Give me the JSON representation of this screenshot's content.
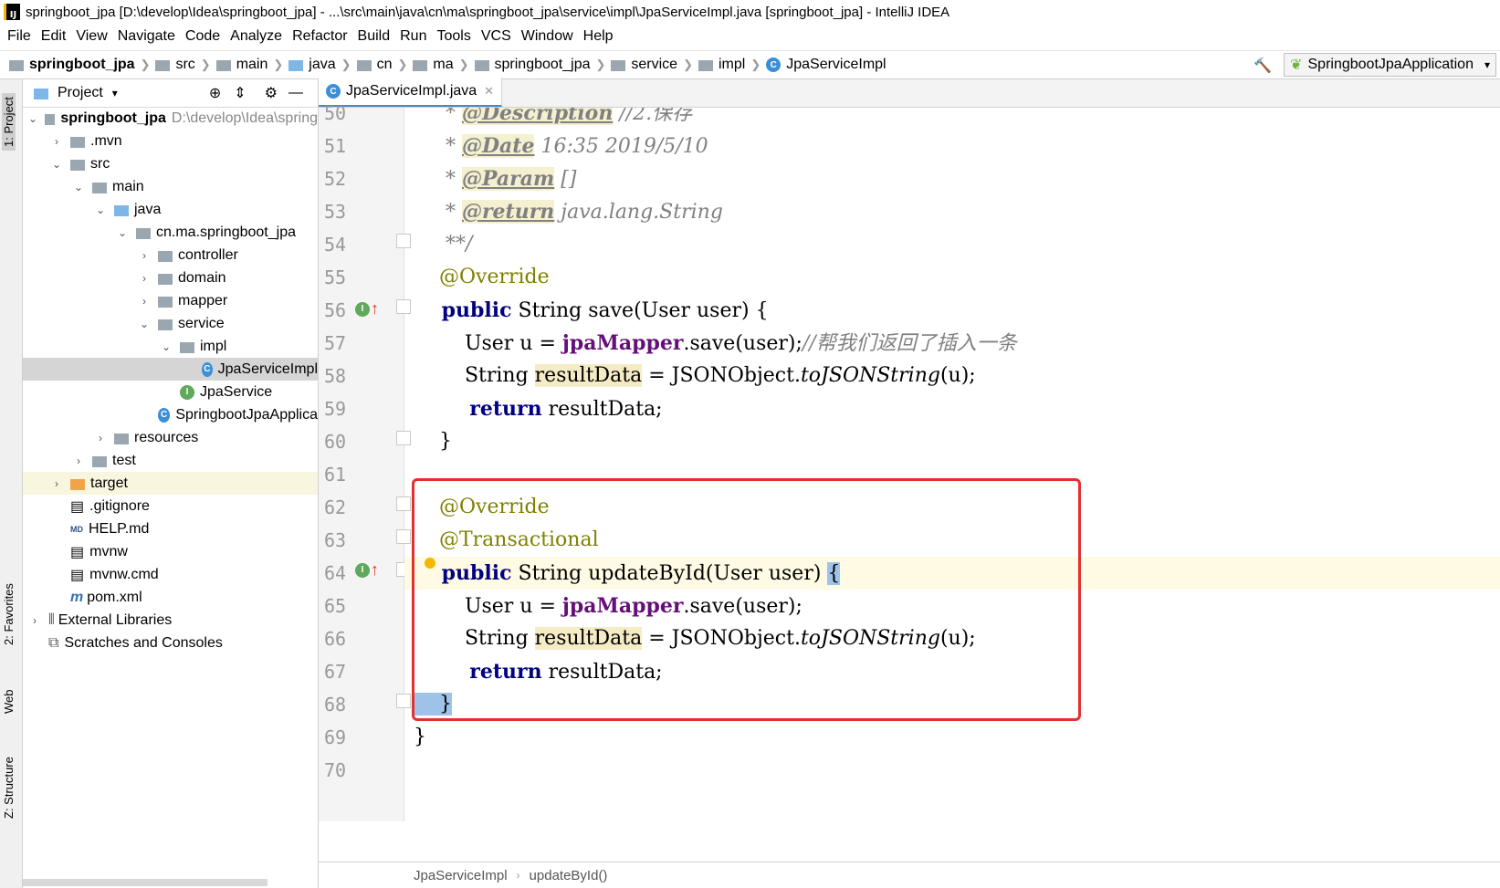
{
  "window": {
    "title": "springboot_jpa [D:\\develop\\Idea\\springboot_jpa] - ...\\src\\main\\java\\cn\\ma\\springboot_jpa\\service\\impl\\JpaServiceImpl.java [springboot_jpa] - IntelliJ IDEA",
    "app_icon": "IJ"
  },
  "menu": [
    "File",
    "Edit",
    "View",
    "Navigate",
    "Code",
    "Analyze",
    "Refactor",
    "Build",
    "Run",
    "Tools",
    "VCS",
    "Window",
    "Help"
  ],
  "breadcrumbs": [
    "springboot_jpa",
    "src",
    "main",
    "java",
    "cn",
    "ma",
    "springboot_jpa",
    "service",
    "impl",
    "JpaServiceImpl"
  ],
  "run_config": "SpringbootJpaApplication",
  "side_tabs": {
    "project": "1: Project",
    "favorites": "2: Favorites",
    "web": "Web",
    "structure": "Z: Structure"
  },
  "project_panel": {
    "title": "Project",
    "tree": [
      {
        "label": "springboot_jpa",
        "extra": "D:\\develop\\Idea\\spring",
        "bold": true,
        "icon": "folder-icon"
      },
      {
        "label": ".mvn",
        "icon": "folder-icon"
      },
      {
        "label": "src",
        "icon": "folder-icon"
      },
      {
        "label": "main",
        "icon": "folder-icon"
      },
      {
        "label": "java",
        "icon": "folder-icon"
      },
      {
        "label": "cn.ma.springboot_jpa",
        "icon": "package-icon"
      },
      {
        "label": "controller",
        "icon": "package-icon"
      },
      {
        "label": "domain",
        "icon": "package-icon"
      },
      {
        "label": "mapper",
        "icon": "package-icon"
      },
      {
        "label": "service",
        "icon": "package-icon"
      },
      {
        "label": "impl",
        "icon": "package-icon"
      },
      {
        "label": "JpaServiceImpl",
        "icon": "class-icon"
      },
      {
        "label": "JpaService",
        "icon": "interface-icon"
      },
      {
        "label": "SpringbootJpaApplica",
        "icon": "class-icon"
      },
      {
        "label": "resources",
        "icon": "folder-icon"
      },
      {
        "label": "test",
        "icon": "folder-icon"
      },
      {
        "label": "target",
        "icon": "folder-icon"
      },
      {
        "label": ".gitignore",
        "icon": "file-icon"
      },
      {
        "label": "HELP.md",
        "icon": "markdown-icon"
      },
      {
        "label": "mvnw",
        "icon": "file-icon"
      },
      {
        "label": "mvnw.cmd",
        "icon": "file-icon"
      },
      {
        "label": "pom.xml",
        "icon": "maven-icon"
      },
      {
        "label": "External Libraries",
        "icon": "library-icon"
      },
      {
        "label": "Scratches and Consoles",
        "icon": "scratches-icon"
      }
    ]
  },
  "editor": {
    "tab": "JpaServiceImpl.java",
    "line_numbers": [
      "50",
      "51",
      "52",
      "53",
      "54",
      "55",
      "56",
      "57",
      "58",
      "59",
      "60",
      "61",
      "62",
      "63",
      "64",
      "65",
      "66",
      "67",
      "68",
      "69",
      "70"
    ],
    "lines": [
      {
        "n": "50",
        "parts": [
          [
            "cm",
            "     * "
          ],
          [
            "tag",
            "@Description"
          ],
          [
            "cm",
            " //2.保存"
          ]
        ]
      },
      {
        "n": "51",
        "parts": [
          [
            "cm",
            "     * "
          ],
          [
            "tag",
            "@Date"
          ],
          [
            "cm",
            " 16:35 2019/5/10"
          ]
        ]
      },
      {
        "n": "52",
        "parts": [
          [
            "cm",
            "     * "
          ],
          [
            "tag",
            "@Param"
          ],
          [
            "cm",
            " []"
          ]
        ]
      },
      {
        "n": "53",
        "parts": [
          [
            "cm",
            "     * "
          ],
          [
            "tag",
            "@return"
          ],
          [
            "cm",
            " java.lang.String"
          ]
        ]
      },
      {
        "n": "54",
        "parts": [
          [
            "cm",
            "     **/"
          ]
        ]
      },
      {
        "n": "55",
        "parts": [
          [
            "ann",
            "    @Override"
          ]
        ]
      },
      {
        "n": "56",
        "parts": [
          [
            "kw",
            "    public"
          ],
          [
            "",
            " String save(User user) {"
          ]
        ]
      },
      {
        "n": "57",
        "parts": [
          [
            "",
            "        User u = "
          ],
          [
            "fld",
            "jpaMapper"
          ],
          [
            "",
            ".save(user);"
          ],
          [
            "cm",
            "//帮我们返回了插入一条"
          ]
        ]
      },
      {
        "n": "58",
        "parts": [
          [
            "",
            "        String "
          ],
          [
            "hl",
            "resultData"
          ],
          [
            "",
            " = JSONObject."
          ],
          [
            "it",
            "toJSONString"
          ],
          [
            "",
            "(u);"
          ]
        ]
      },
      {
        "n": "59",
        "parts": [
          [
            "kw",
            "        return"
          ],
          [
            "",
            " resultData;"
          ]
        ]
      },
      {
        "n": "60",
        "parts": [
          [
            "",
            "    }"
          ]
        ]
      },
      {
        "n": "61",
        "parts": []
      },
      {
        "n": "62",
        "parts": [
          [
            "ann",
            "    @Override"
          ]
        ]
      },
      {
        "n": "63",
        "parts": [
          [
            "ann",
            "    @Transactional"
          ]
        ]
      },
      {
        "n": "64",
        "parts": [
          [
            "kw",
            "    public"
          ],
          [
            "",
            " String updateById(User user) "
          ],
          [
            "brace",
            "{"
          ]
        ]
      },
      {
        "n": "65",
        "parts": [
          [
            "",
            "        User u = "
          ],
          [
            "fld",
            "jpaMapper"
          ],
          [
            "",
            ".save(user);"
          ]
        ]
      },
      {
        "n": "66",
        "parts": [
          [
            "",
            "        String "
          ],
          [
            "hl",
            "resultData"
          ],
          [
            "",
            " = JSONObject."
          ],
          [
            "it",
            "toJSONString"
          ],
          [
            "",
            "(u);"
          ]
        ]
      },
      {
        "n": "67",
        "parts": [
          [
            "kw",
            "        return"
          ],
          [
            "",
            " resultData;"
          ]
        ]
      },
      {
        "n": "68",
        "parts": [
          [
            "brace",
            "    }"
          ]
        ]
      },
      {
        "n": "69",
        "parts": [
          [
            "",
            "}"
          ]
        ]
      },
      {
        "n": "70",
        "parts": []
      }
    ]
  },
  "status_breadcrumb": [
    "JpaServiceImpl",
    "updateById()"
  ],
  "colors": {
    "highlight_box": "#e53030",
    "keyword": "#000080",
    "annotation": "#808000",
    "comment": "#808080",
    "field": "#660e7a"
  }
}
